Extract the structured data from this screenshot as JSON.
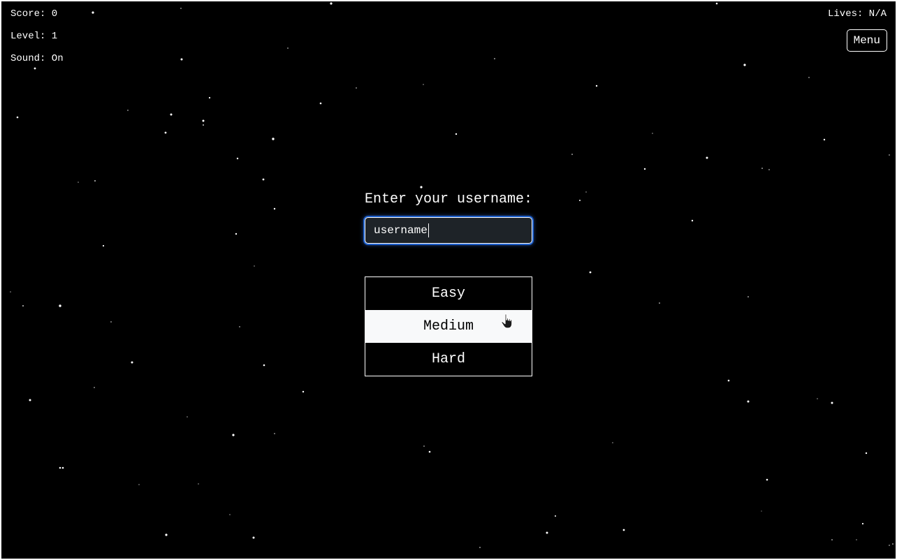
{
  "hud": {
    "score": "Score: 0",
    "level": "Level: 1",
    "sound": "Sound: On",
    "lives": "Lives: N/A"
  },
  "menu": {
    "label": "Menu"
  },
  "login": {
    "prompt": "Enter your username:",
    "username_value": "username"
  },
  "difficulty": {
    "options": [
      "Easy",
      "Medium",
      "Hard"
    ],
    "selected": "Medium"
  },
  "colors": {
    "background": "#000000",
    "text": "#ffffff",
    "input_background": "#1e2328",
    "focus_ring": "#1d5fcc",
    "selected_background": "#f8f9fa",
    "selected_text": "#000000"
  },
  "icons": {
    "cursor": "hand-pointer-icon",
    "background": "starfield"
  }
}
